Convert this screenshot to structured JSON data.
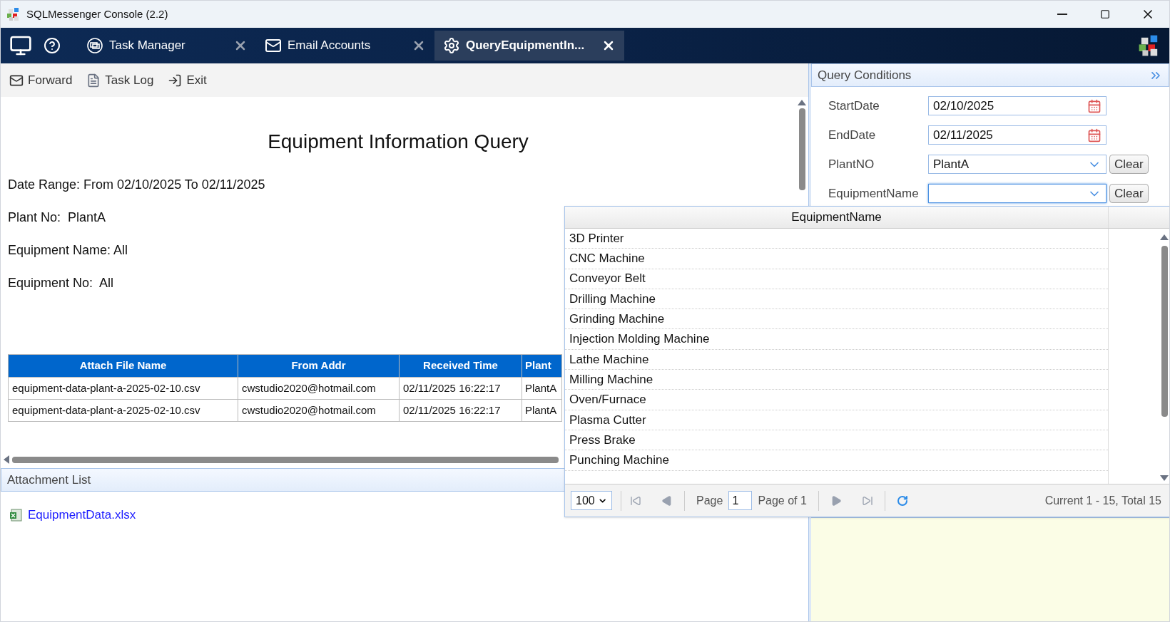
{
  "window": {
    "title": "SQLMessenger Console (2.2)"
  },
  "tabs": [
    {
      "label": "Task Manager",
      "selected": false
    },
    {
      "label": "Email Accounts",
      "selected": false
    },
    {
      "label": "QueryEquipmentIn...",
      "selected": true
    }
  ],
  "toolbar": [
    "Forward",
    "Task Log",
    "Exit"
  ],
  "report": {
    "title": "Equipment Information Query",
    "lines": [
      "Date Range: From 02/10/2025 To 02/11/2025",
      "Plant No:  PlantA",
      "Equipment Name: All",
      "Equipment No:  All"
    ],
    "table": {
      "columns": [
        "Attach File Name",
        "From Addr",
        "Received Time",
        "Plant"
      ],
      "rows": [
        [
          "equipment-data-plant-a-2025-02-10.csv",
          "cwstudio2020@hotmail.com",
          "02/11/2025 16:22:17",
          "PlantA"
        ],
        [
          "equipment-data-plant-a-2025-02-10.csv",
          "cwstudio2020@hotmail.com",
          "02/11/2025 16:22:17",
          "PlantA"
        ]
      ]
    }
  },
  "attachments": {
    "title": "Attachment List",
    "files": [
      "EquipmentData.xlsx"
    ]
  },
  "query_conditions": {
    "title": "Query Conditions",
    "fields": [
      {
        "label": "StartDate",
        "kind": "date",
        "value": "02/10/2025"
      },
      {
        "label": "EndDate",
        "kind": "date",
        "value": "02/11/2025"
      },
      {
        "label": "PlantNO",
        "kind": "combo",
        "value": "PlantA",
        "button": "Clear"
      },
      {
        "label": "EquipmentName",
        "kind": "combo",
        "button": "Clear",
        "focused": true
      }
    ]
  },
  "dropdown": {
    "column": "EquipmentName",
    "items": [
      "3D Printer",
      "CNC Machine",
      "Conveyor Belt",
      "Drilling Machine",
      "Grinding Machine",
      "Injection Molding Machine",
      "Lathe Machine",
      "Milling Machine",
      "Oven/Furnace",
      "Plasma Cutter",
      "Press Brake",
      "Punching Machine"
    ],
    "page_size": "100",
    "page_label": "Page",
    "page": "1",
    "page_of": "Page of 1",
    "summary": "Current 1 - 15, Total 15"
  }
}
